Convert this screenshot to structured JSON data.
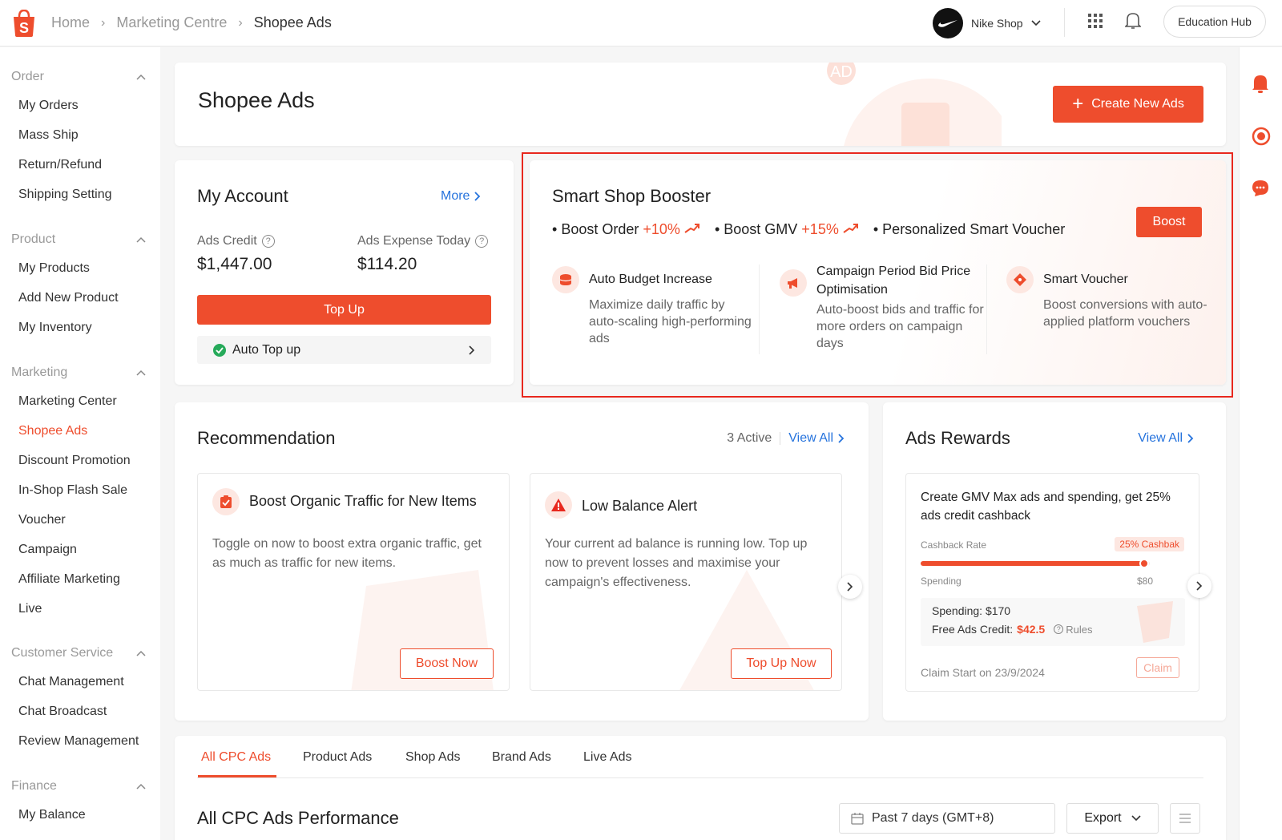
{
  "header": {
    "breadcrumbs": [
      "Home",
      "Marketing Centre",
      "Shopee Ads"
    ],
    "shop_name": "Nike Shop",
    "education_hub": "Education Hub"
  },
  "sidebar": {
    "sections": [
      {
        "title": "Order",
        "items": [
          "My Orders",
          "Mass Ship",
          "Return/Refund",
          "Shipping Setting"
        ]
      },
      {
        "title": "Product",
        "items": [
          "My Products",
          "Add New Product",
          "My Inventory"
        ]
      },
      {
        "title": "Marketing",
        "items": [
          "Marketing Center",
          "Shopee Ads",
          "Discount Promotion",
          "In-Shop Flash Sale",
          "Voucher",
          "Campaign",
          "Affiliate Marketing",
          "Live"
        ]
      },
      {
        "title": "Customer Service",
        "items": [
          "Chat Management",
          "Chat Broadcast",
          "Review Management"
        ]
      },
      {
        "title": "Finance",
        "items": [
          "My Balance"
        ]
      }
    ],
    "active_item": "Shopee Ads"
  },
  "page": {
    "title": "Shopee Ads",
    "create_button": "Create New Ads",
    "banner_badge": "AD"
  },
  "account": {
    "title": "My Account",
    "more": "More",
    "credit_label": "Ads Credit",
    "credit_value": "$1,447.00",
    "expense_label": "Ads Expense Today",
    "expense_value": "$114.20",
    "topup_button": "Top Up",
    "auto_topup": "Auto Top up"
  },
  "booster": {
    "title": "Smart Shop Booster",
    "boost_button": "Boost",
    "bullets": [
      {
        "label": "Boost Order",
        "value": "+10%"
      },
      {
        "label": "Boost GMV",
        "value": "+15%"
      },
      {
        "label": "Personalized Smart Voucher",
        "value": ""
      }
    ],
    "features": [
      {
        "title": "Auto Budget Increase",
        "desc": "Maximize daily traffic by auto-scaling high-performing ads",
        "icon": "coins-icon"
      },
      {
        "title": "Campaign Period Bid Price Optimisation",
        "desc": "Auto-boost bids and traffic for more orders on campaign days",
        "icon": "megaphone-icon"
      },
      {
        "title": "Smart Voucher",
        "desc": "Boost conversions with auto-applied platform vouchers",
        "icon": "voucher-icon"
      }
    ],
    "highlight_color": "#e8281e"
  },
  "recommendation": {
    "title": "Recommendation",
    "active_count": "3 Active",
    "view_all": "View All",
    "cards": [
      {
        "title": "Boost Organic Traffic for New Items",
        "desc": "Toggle on now to boost extra organic traffic, get as much as traffic for new items.",
        "button": "Boost Now",
        "icon": "clipboard-check-icon"
      },
      {
        "title": "Low Balance Alert",
        "desc": "Your current ad balance is running low.  Top up now to prevent losses and maximise your campaign's effectiveness.",
        "button": "Top Up Now",
        "icon": "warning-icon"
      }
    ]
  },
  "rewards": {
    "title": "Ads Rewards",
    "view_all": "View All",
    "offer": "Create GMV Max ads and spending, get 25% ads credit cashback",
    "rate_label": "Cashback Rate",
    "rate_badge": "25% Cashbak",
    "spending_label": "Spending",
    "spending_max": "$80",
    "progress": 0.98,
    "spending_line": "Spending: $170",
    "free_credit_label": "Free Ads Credit:",
    "free_credit_value": "$42.5",
    "rules": "Rules",
    "claim_start": "Claim Start on 23/9/2024",
    "claim_button": "Claim"
  },
  "tabs": [
    "All CPC Ads",
    "Product Ads",
    "Shop Ads",
    "Brand Ads",
    "Live Ads"
  ],
  "performance": {
    "title": "All CPC Ads Performance",
    "date_range": "Past 7 days (GMT+8)",
    "export": "Export"
  },
  "colors": {
    "brand": "#ee4d2d",
    "link": "#2673dd"
  }
}
